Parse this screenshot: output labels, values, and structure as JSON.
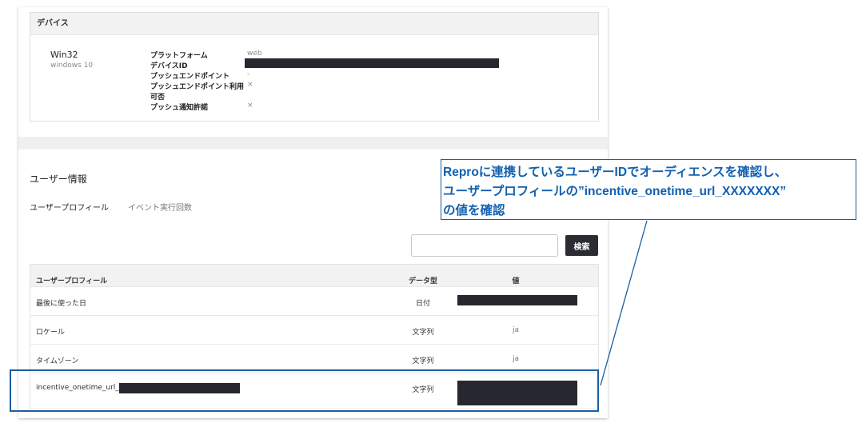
{
  "device": {
    "header": "デバイス",
    "os": "Win32",
    "version": "windows 10",
    "fields": [
      {
        "label": "プラットフォーム",
        "value": "web"
      },
      {
        "label": "デバイスID",
        "value": ""
      },
      {
        "label": "プッシュエンドポイント",
        "value": "-"
      },
      {
        "label": "プッシュエンドポイント利用",
        "value": "×"
      },
      {
        "label": "可否",
        "value": ""
      },
      {
        "label": "プッシュ通知許諾",
        "value": "×"
      }
    ]
  },
  "user_info": {
    "title": "ユーザー情報",
    "tabs": [
      "ユーザープロフィール",
      "イベント実行回数"
    ]
  },
  "search": {
    "placeholder": "",
    "button_label": "検索"
  },
  "table": {
    "headers": [
      "ユーザープロフィール",
      "データ型",
      "値"
    ],
    "rows": [
      {
        "profile": "最後に使った日",
        "type": "日付",
        "value": ""
      },
      {
        "profile": "ロケール",
        "type": "文字列",
        "value": "ja"
      },
      {
        "profile": "タイムゾーン",
        "type": "文字列",
        "value": "ja"
      },
      {
        "profile": "incentive_onetime_url_",
        "type": "文字列",
        "value": ""
      }
    ]
  },
  "annotation": {
    "lines": [
      "Reproに連携しているユーザーIDでオーディエンスを確認し、",
      "ユーザープロフィールの”incentive_onetime_url_XXXXXXX”",
      "の値を確認"
    ],
    "color": "#1160b0"
  }
}
